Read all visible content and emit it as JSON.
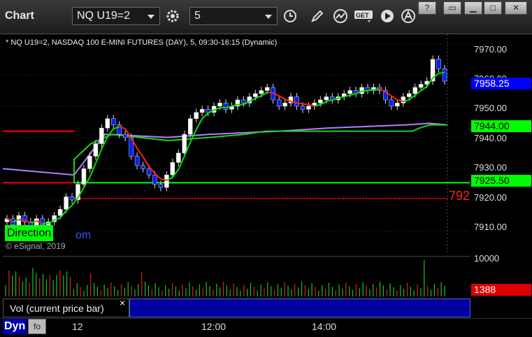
{
  "window": {
    "title": "Chart"
  },
  "toolbar": {
    "symbol": "NQ U19=2",
    "interval": "5"
  },
  "chart": {
    "header": "* NQ U19=2, NASDAQ 100 E-MINI FUTURES (DAY), 5, 09:30-16:15 (Dynamic)",
    "copyright": "© eSignal, 2019",
    "direction_label": "Direction",
    "direction_suffix": "om",
    "ylabels": [
      "7970.00",
      "7960.00",
      "7950.00",
      "7940.00",
      "7930.00",
      "7920.00",
      "7910.00"
    ],
    "ylabel_right_partial": "792",
    "price_labels": [
      {
        "text": "7958.25",
        "bg": "#0000ff",
        "fg": "#ffffff"
      },
      {
        "text": "7944.00",
        "bg": "#00ff00",
        "fg": "#000000"
      },
      {
        "text": "7925.50",
        "bg": "#00ff00",
        "fg": "#000000"
      }
    ],
    "xlabels": [
      "12",
      "12:00",
      "14:00"
    ]
  },
  "volume": {
    "legend": "Vol (current price bar)",
    "ytick": "10000",
    "price_label": "1388"
  },
  "statusbar": {
    "dyn_label": "Dyn"
  },
  "chart_data": {
    "type": "candlestick",
    "title": "* NQ U19=2, NASDAQ 100 E-MINI FUTURES (DAY), 5, 09:30-16:15 (Dynamic)",
    "ylim": [
      7903,
      7973
    ],
    "closes": [
      7914,
      7912,
      7915,
      7913,
      7911,
      7914,
      7912,
      7913,
      7915,
      7917,
      7921,
      7920,
      7925,
      7930,
      7934,
      7938,
      7943,
      7946,
      7944,
      7941,
      7940,
      7934,
      7931,
      7930,
      7928,
      7925,
      7924,
      7928,
      7932,
      7935,
      7941,
      7946,
      7948,
      7949,
      7948,
      7950,
      7951,
      7949,
      7950,
      7952,
      7951,
      7953,
      7954,
      7955,
      7956,
      7952,
      7950,
      7951,
      7953,
      7950,
      7949,
      7950,
      7951,
      7952,
      7953,
      7952,
      7953,
      7954,
      7955,
      7954,
      7956,
      7955,
      7956,
      7955,
      7952,
      7950,
      7951,
      7953,
      7954,
      7956,
      7957,
      7958,
      7965,
      7962,
      7958
    ],
    "reference_lines": [
      7942,
      7925.5,
      7920.5
    ],
    "series": [
      {
        "name": "",
        "values": [
          7938,
          7935,
          7943,
          7944
        ]
      },
      {
        "name": "",
        "values": [
          7925.5,
          7938,
          7941,
          7944
        ]
      }
    ]
  }
}
